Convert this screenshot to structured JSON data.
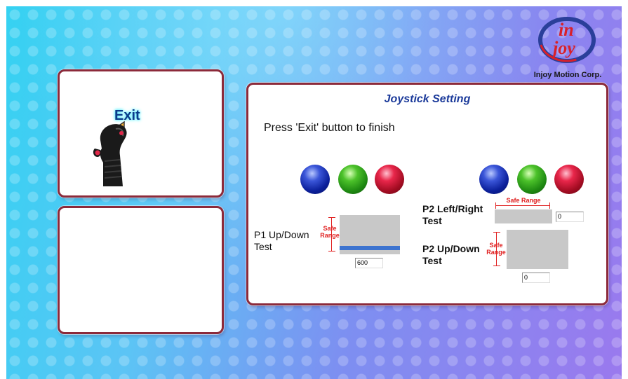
{
  "logo": {
    "mark_text_top": "in",
    "mark_text_bottom": "joy",
    "caption": "Injoy Motion Corp."
  },
  "exit_panel": {
    "exit_label": "Exit",
    "icon": "joystick-icon"
  },
  "main": {
    "title": "Joystick Setting",
    "instruction": "Press 'Exit' button to finish",
    "p1_buttons": [
      "blue",
      "green",
      "red"
    ],
    "p2_buttons": [
      "blue",
      "green",
      "red"
    ],
    "p1_updown": {
      "label_line1": "P1 Up/Down",
      "label_line2": "Test",
      "safe_line1": "Safe",
      "safe_line2": "Range",
      "value": "600",
      "bar_level": 0.88
    },
    "p2_leftright": {
      "label_line1": "P2 Left/Right",
      "label_line2": "Test",
      "safe_range": "Safe Range",
      "value": "0"
    },
    "p2_updown": {
      "label_line1": "P2 Up/Down",
      "label_line2": "Test",
      "safe_line1": "Safe",
      "safe_line2": "Range",
      "value": "0"
    }
  },
  "colors": {
    "panel_border": "#8c2a3a",
    "title": "#1b3a9a",
    "safe_range": "#e02020",
    "bar": "#3c73cf"
  }
}
